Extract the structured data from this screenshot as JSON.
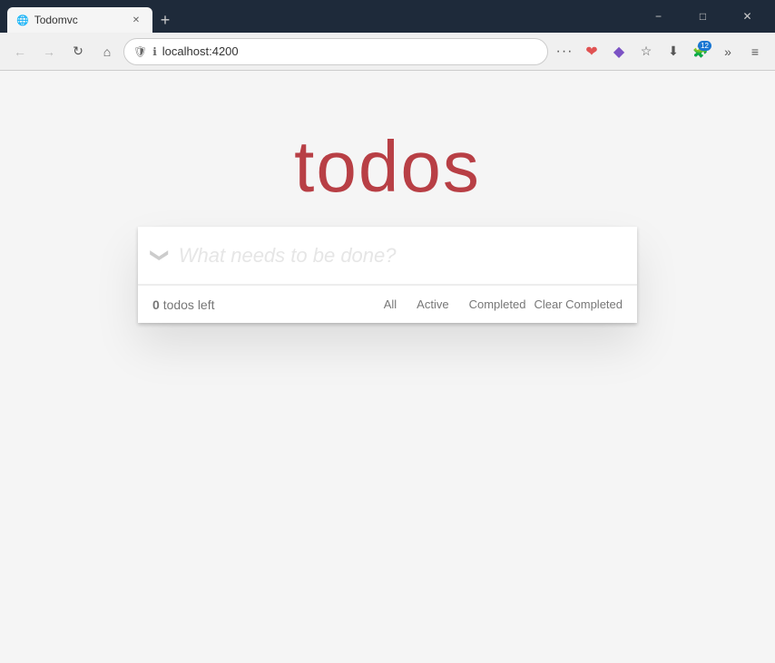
{
  "browser": {
    "tab_title": "Todomvc",
    "url": "localhost:4200",
    "new_tab_icon": "+",
    "back_icon": "←",
    "forward_icon": "→",
    "refresh_icon": "↻",
    "home_icon": "⌂",
    "more_icon": "···",
    "bookmark_icon": "☆",
    "download_icon": "⬇",
    "extensions_icon": "🧩",
    "badge_count": "12",
    "menu_icon": "≡",
    "minimize_icon": "−",
    "maximize_icon": "□",
    "close_icon": "✕"
  },
  "app": {
    "title": "todos",
    "input_placeholder": "What needs to be done?",
    "toggle_all_symbol": "❯",
    "todo_count": "0",
    "todos_left_label": "todos left",
    "filters": [
      {
        "label": "All",
        "active": false
      },
      {
        "label": "Active",
        "active": false
      },
      {
        "label": "Completed",
        "active": false
      }
    ],
    "clear_completed_label": "Clear Completed"
  }
}
